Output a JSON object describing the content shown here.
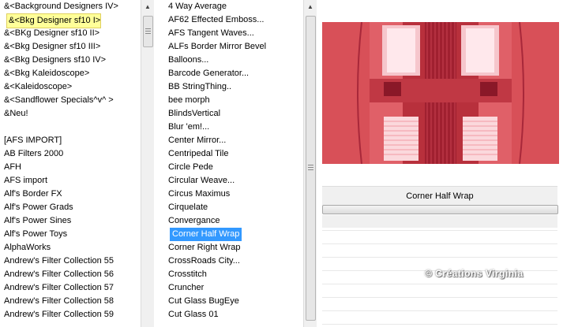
{
  "left_list": {
    "items": [
      "&<Background Designers IV>",
      "&<Bkg Designer sf10 I>",
      "&<BKg Designer sf10 II>",
      "&<Bkg Designer sf10 III>",
      "&<Bkg Designers sf10 IV>",
      "&<Bkg Kaleidoscope>",
      "&<Kaleidoscope>",
      "&<Sandflower Specials^v^ >",
      "&Neu!",
      "",
      "[AFS IMPORT]",
      "AB Filters 2000",
      "AFH",
      "AFS import",
      "Alf's Border FX",
      "Alf's Power Grads",
      "Alf's Power Sines",
      "Alf's Power Toys",
      "AlphaWorks",
      "Andrew's Filter Collection 55",
      "Andrew's Filter Collection 56",
      "Andrew's Filter Collection 57",
      "Andrew's Filter Collection 58",
      "Andrew's Filter Collection 59"
    ],
    "highlighted_index": 1
  },
  "mid_list": {
    "items": [
      "4 Way Average",
      "AF62 Effected Emboss...",
      "AFS Tangent Waves...",
      "ALFs Border Mirror Bevel",
      "Balloons...",
      "Barcode Generator...",
      "BB StringThing..",
      "bee morph",
      "BlindsVertical",
      "Blur 'em!...",
      "Center Mirror...",
      "Centripedal Tile",
      "Circle Pede",
      "Circular Weave...",
      "Circus Maximus",
      "Cirquelate",
      "Convergance",
      "Corner Half Wrap",
      "Corner Right Wrap",
      "CrossRoads City...",
      "Crosstitch",
      "Cruncher",
      "Cut Glass  BugEye",
      "Cut Glass 01"
    ],
    "selected_index": 17
  },
  "right_panel": {
    "effect_name": "Corner Half Wrap",
    "watermark": "© Créations Virginia"
  },
  "colors": {
    "selection": "#3399ff",
    "highlight": "#ffff99",
    "preview_base": "#e06068",
    "preview_dark": "#b8303c"
  }
}
